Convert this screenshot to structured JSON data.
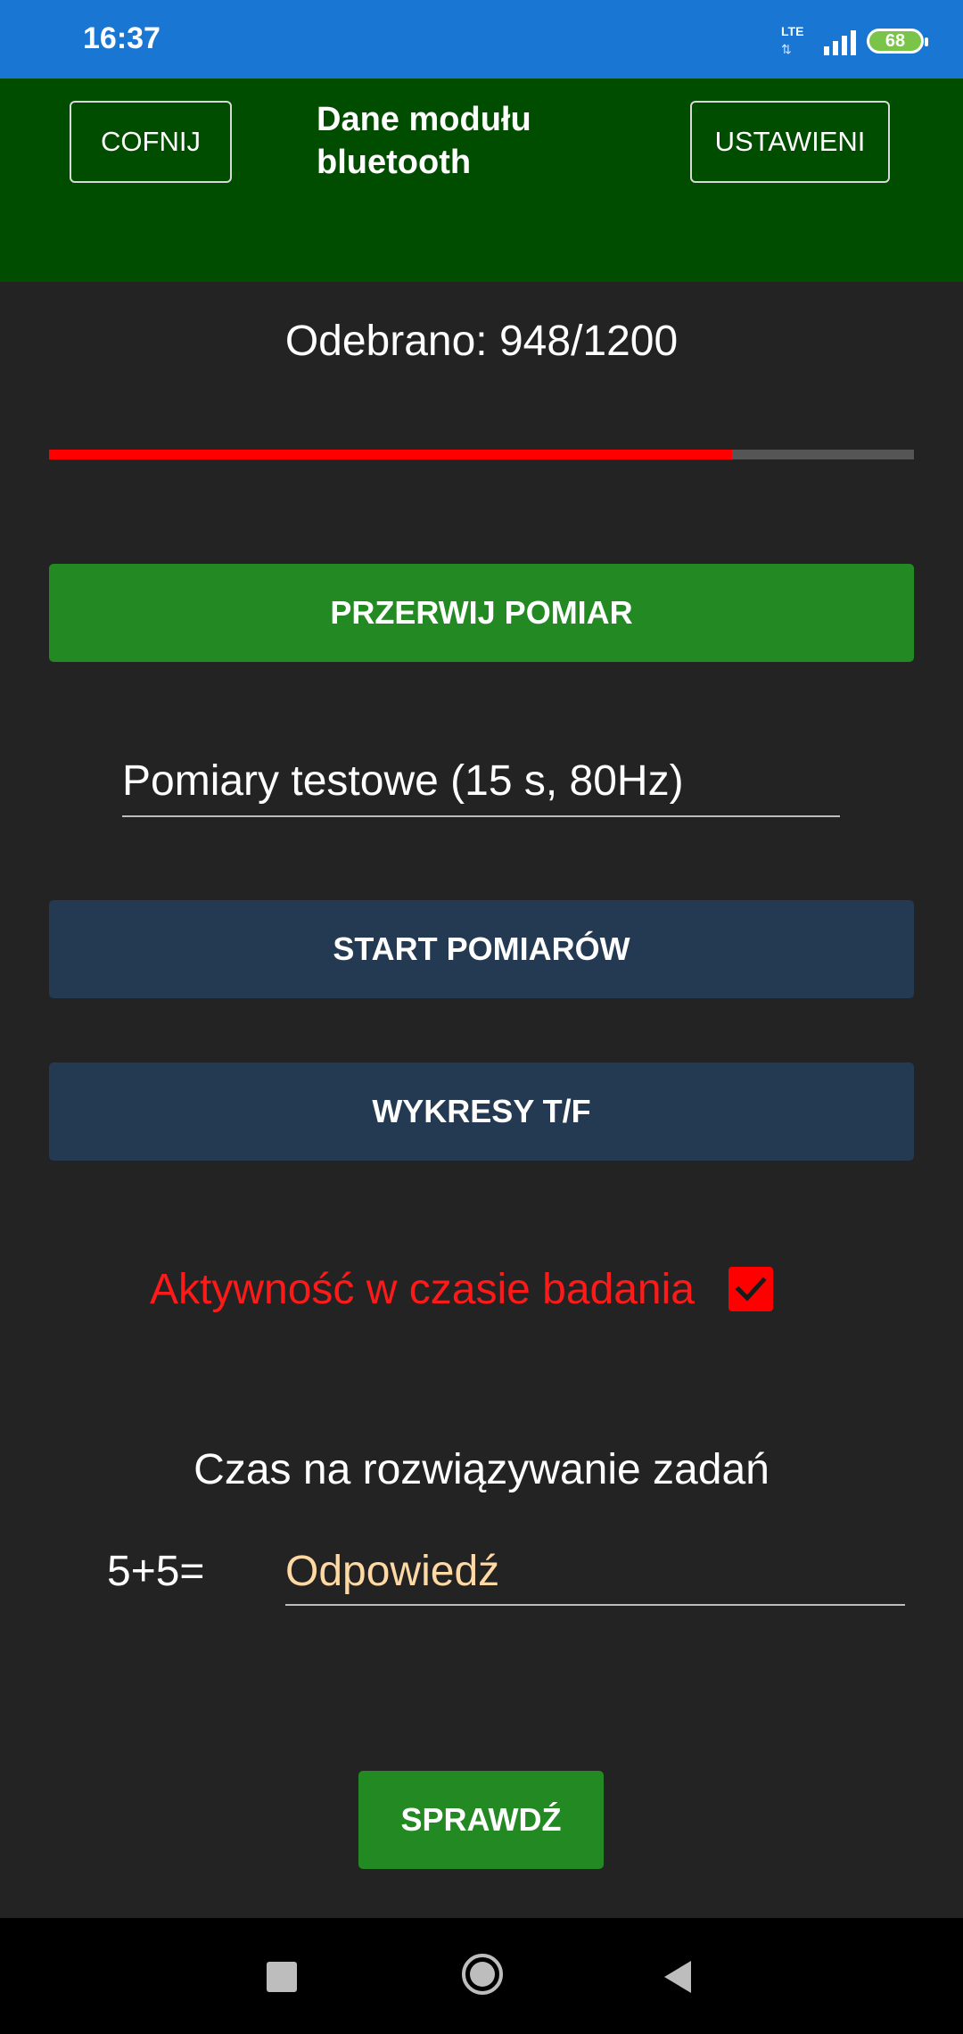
{
  "status_bar": {
    "time": "16:37",
    "network": "LTE",
    "battery": "68"
  },
  "header": {
    "back_label": "COFNIJ",
    "title": "Dane modułu bluetooth",
    "settings_label": "USTAWIENI"
  },
  "progress": {
    "label": "Odebrano: 948/1200",
    "received": 948,
    "total": 1200
  },
  "buttons": {
    "stop": "PRZERWIJ POMIAR",
    "start": "START POMIARÓW",
    "charts": "WYKRESY T/F",
    "check": "SPRAWDŹ"
  },
  "mode_select": {
    "value": "Pomiary testowe (15 s, 80Hz)"
  },
  "activity": {
    "label": "Aktywność w czasie badania",
    "checked": true
  },
  "task": {
    "title": "Czas na rozwiązywanie zadań",
    "equation": "5+5=",
    "answer_placeholder": "Odpowiedź"
  },
  "colors": {
    "status_bar": "#1976d2",
    "header": "#004d00",
    "background": "#232323",
    "accent_green": "#238a23",
    "navy_button": "#233a52",
    "progress": "#ff0000",
    "warning_text": "#ff1a1a",
    "placeholder": "#ffd9a3"
  }
}
